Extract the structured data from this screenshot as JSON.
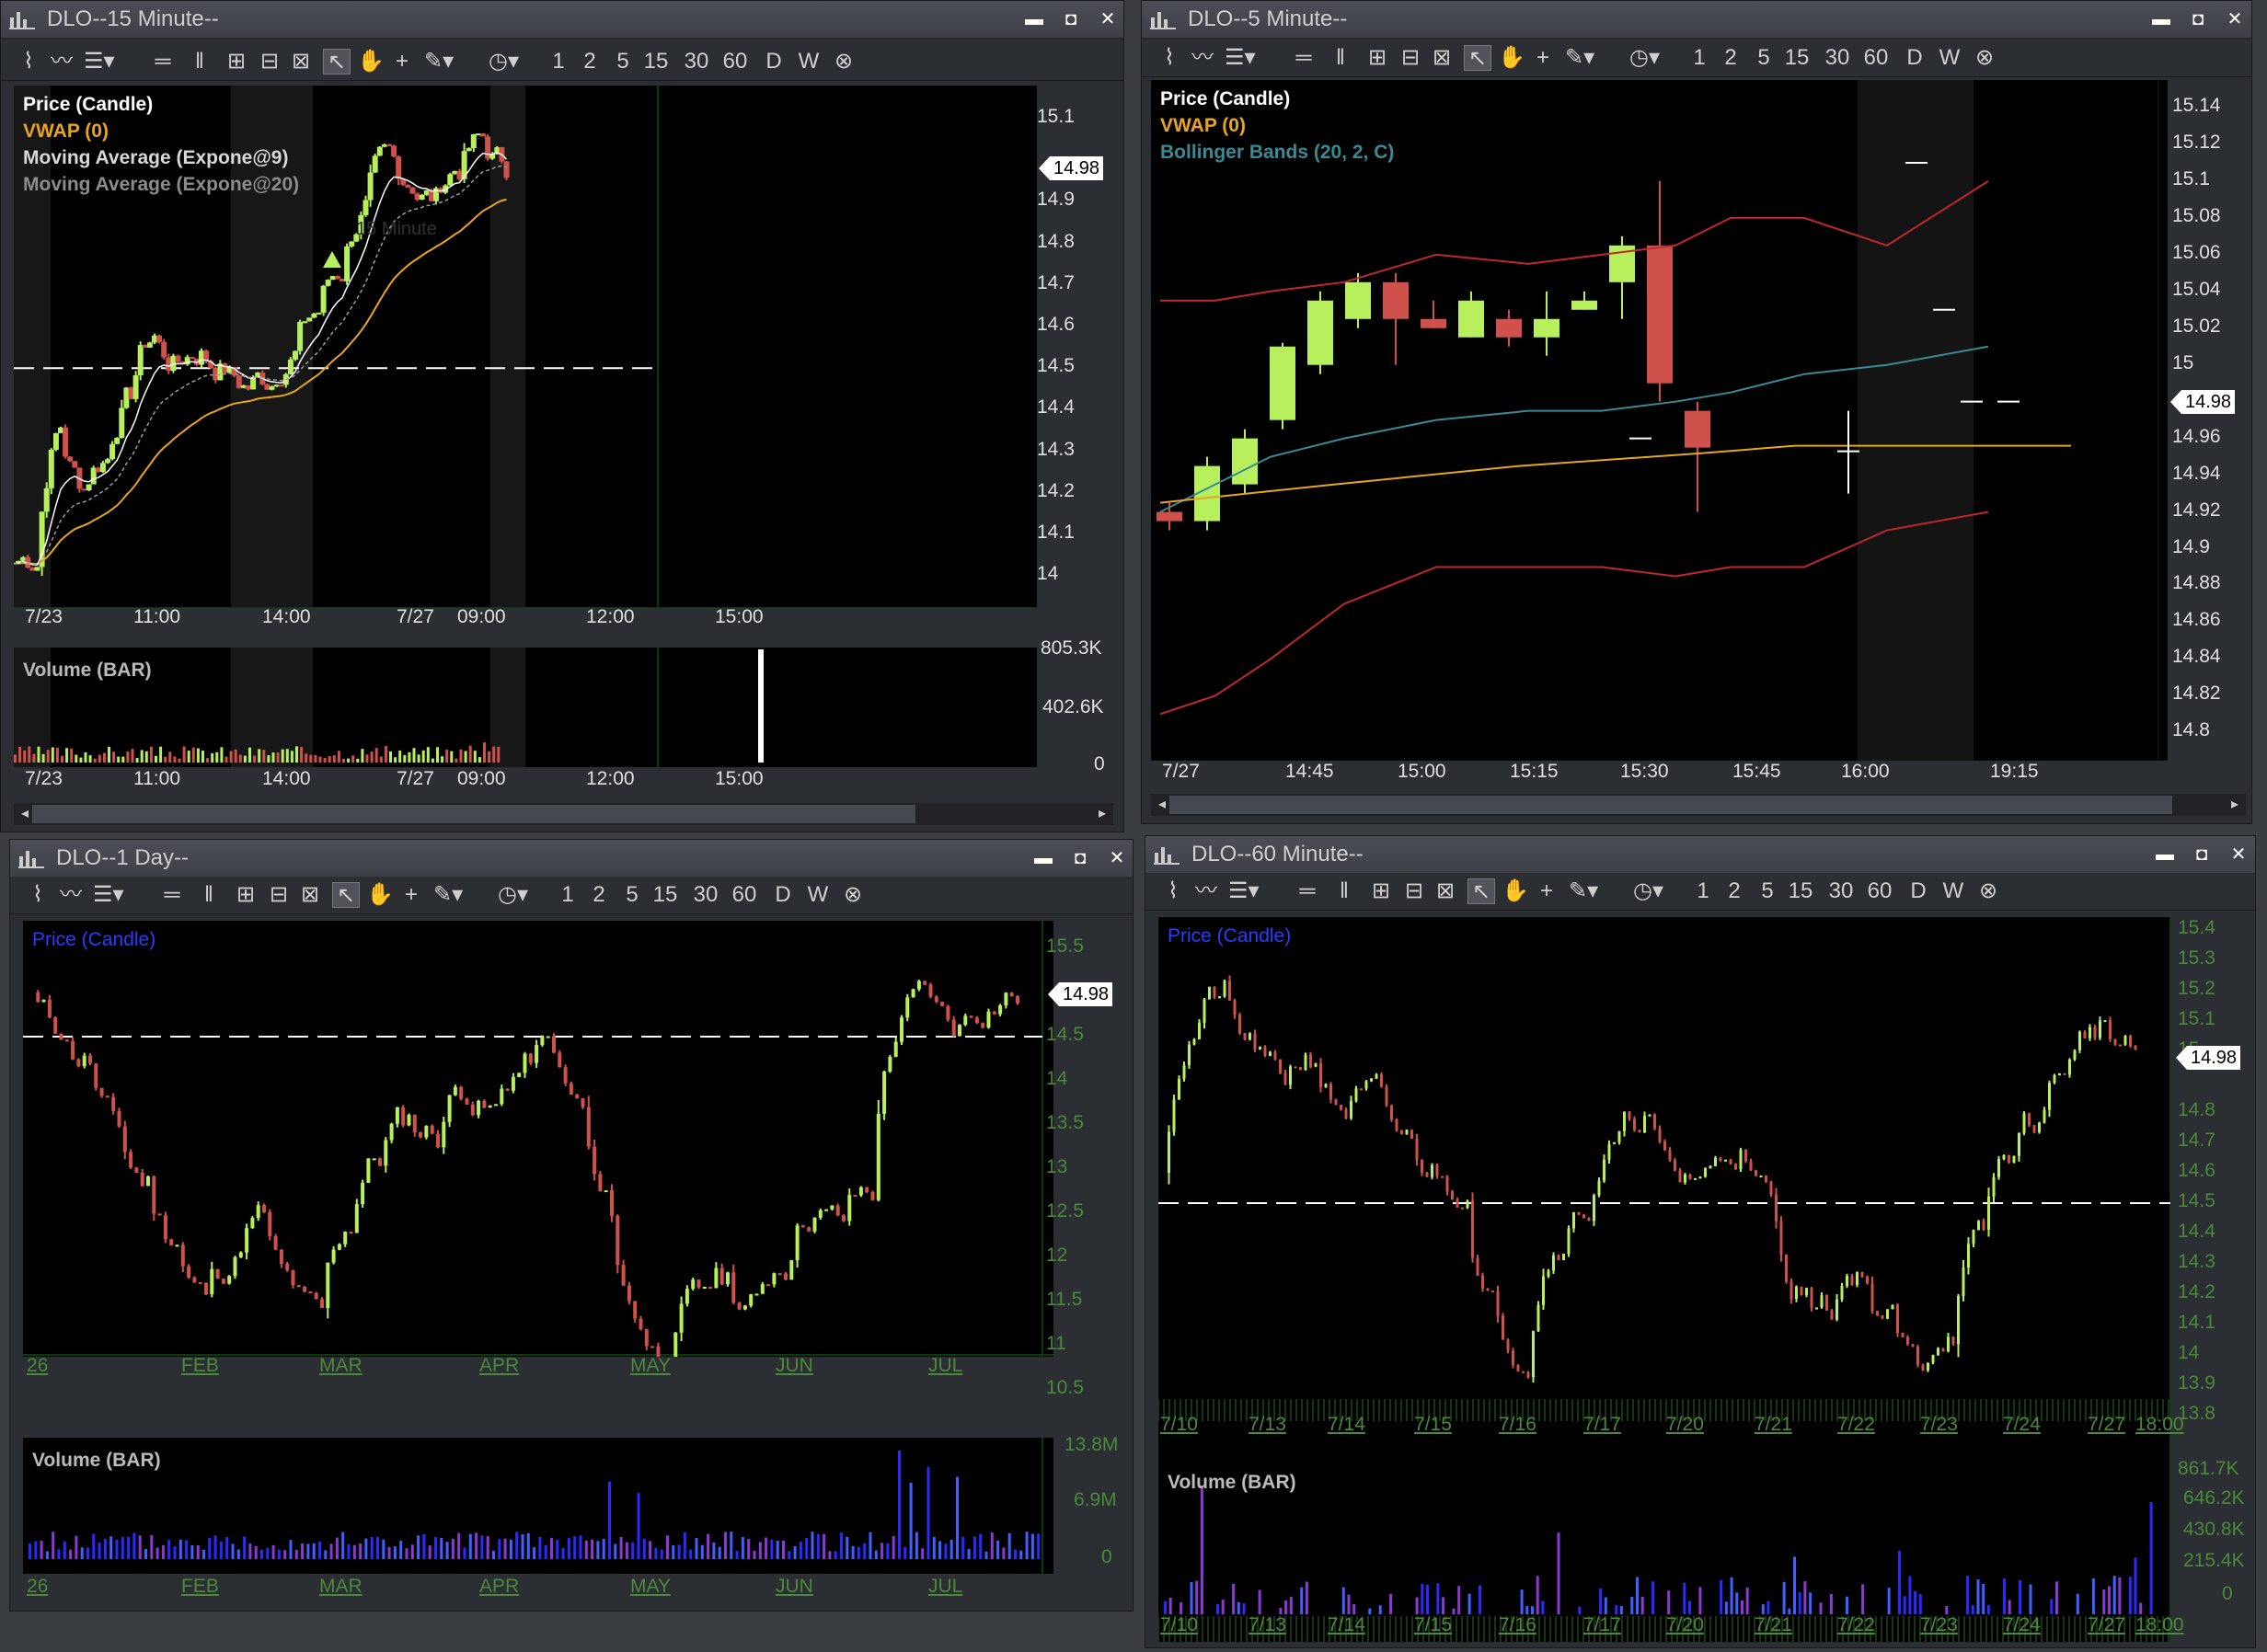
{
  "colors": {
    "up": "#b7f05c",
    "down": "#d0504c",
    "vwap": "#e8a524",
    "ema9": "#ffffff",
    "ema20": "#9c9c9c",
    "bb": "#3a8a95",
    "bbband": "#c0282e",
    "dashed": "#ffffff",
    "grid": "#0a3b0a"
  },
  "icons": {
    "logo": "chart-logo-icon",
    "minimize": "minimize-icon",
    "maximize": "maximize-icon",
    "close": "close-icon"
  },
  "toolbar_labels": {
    "i1": "1",
    "i2": "2",
    "i5": "5",
    "i15": "15",
    "i30": "30",
    "i60": "60",
    "d": "D",
    "w": "W"
  },
  "w15": {
    "title": "DLO--15 Minute--",
    "legend": [
      "Price (Candle)",
      "VWAP (0)",
      "Moving Average (Expone@9)",
      "Moving Average (Expone@20)"
    ],
    "price_ticks": [
      "15.1",
      "15",
      "14.9",
      "14.8",
      "14.7",
      "14.6",
      "14.5",
      "14.4",
      "14.3",
      "14.2",
      "14.1",
      "14"
    ],
    "last_price": "14.98",
    "x_labels": [
      "7/23",
      "11:00",
      "14:00",
      "7/27",
      "09:00",
      "12:00",
      "15:00"
    ],
    "vol_title": "Volume (BAR)",
    "vol_ticks": [
      "805.3K",
      "402.6K",
      "0"
    ],
    "vol_x_labels": [
      "7/23",
      "11:00",
      "14:00",
      "7/27",
      "09:00",
      "12:00",
      "15:00"
    ],
    "ghost_text": "15 Minute"
  },
  "w5": {
    "title": "DLO--5 Minute--",
    "legend": [
      "Price (Candle)",
      "VWAP (0)",
      "Bollinger Bands (20, 2, C)"
    ],
    "price_ticks": [
      "15.14",
      "15.12",
      "15.1",
      "15.08",
      "15.06",
      "15.04",
      "15.02",
      "15",
      "14.98",
      "14.96",
      "14.94",
      "14.92",
      "14.9",
      "14.88",
      "14.86",
      "14.84",
      "14.82",
      "14.8"
    ],
    "last_price": "14.98",
    "x_labels": [
      "7/27",
      "14:45",
      "15:00",
      "15:15",
      "15:30",
      "15:45",
      "16:00",
      "19:15"
    ]
  },
  "w1d": {
    "title": "DLO--1 Day--",
    "legend": [
      "Price (Candle)"
    ],
    "price_ticks": [
      "15.5",
      "15",
      "14.5",
      "14",
      "13.5",
      "13",
      "12.5",
      "12",
      "11.5",
      "11",
      "10.5"
    ],
    "last_price": "14.98",
    "x_labels": [
      "26",
      "FEB",
      "MAR",
      "APR",
      "MAY",
      "JUN",
      "JUL"
    ],
    "vol_title": "Volume (BAR)",
    "vol_ticks": [
      "13.8M",
      "6.9M",
      "0"
    ],
    "vol_x_labels": [
      "26",
      "FEB",
      "MAR",
      "APR",
      "MAY",
      "JUN",
      "JUL"
    ]
  },
  "w60": {
    "title": "DLO--60 Minute--",
    "legend": [
      "Price (Candle)"
    ],
    "price_ticks": [
      "15.4",
      "15.3",
      "15.2",
      "15.1",
      "15",
      "14.9",
      "14.8",
      "14.7",
      "14.6",
      "14.5",
      "14.4",
      "14.3",
      "14.2",
      "14.1",
      "14",
      "13.9",
      "13.8"
    ],
    "last_price": "14.98",
    "x_labels": [
      "7/10",
      "7/13",
      "7/14",
      "7/15",
      "7/16",
      "7/17",
      "7/20",
      "7/21",
      "7/22",
      "7/23",
      "7/24",
      "7/27",
      "18:00"
    ],
    "vol_title": "Volume (BAR)",
    "vol_ticks": [
      "861.7K",
      "646.2K",
      "430.8K",
      "215.4K",
      "0"
    ],
    "vol_x_labels": [
      "7/10",
      "7/13",
      "7/14",
      "7/15",
      "7/16",
      "7/17",
      "7/20",
      "7/21",
      "7/22",
      "7/23",
      "7/24",
      "7/27",
      "18:00"
    ]
  }
}
